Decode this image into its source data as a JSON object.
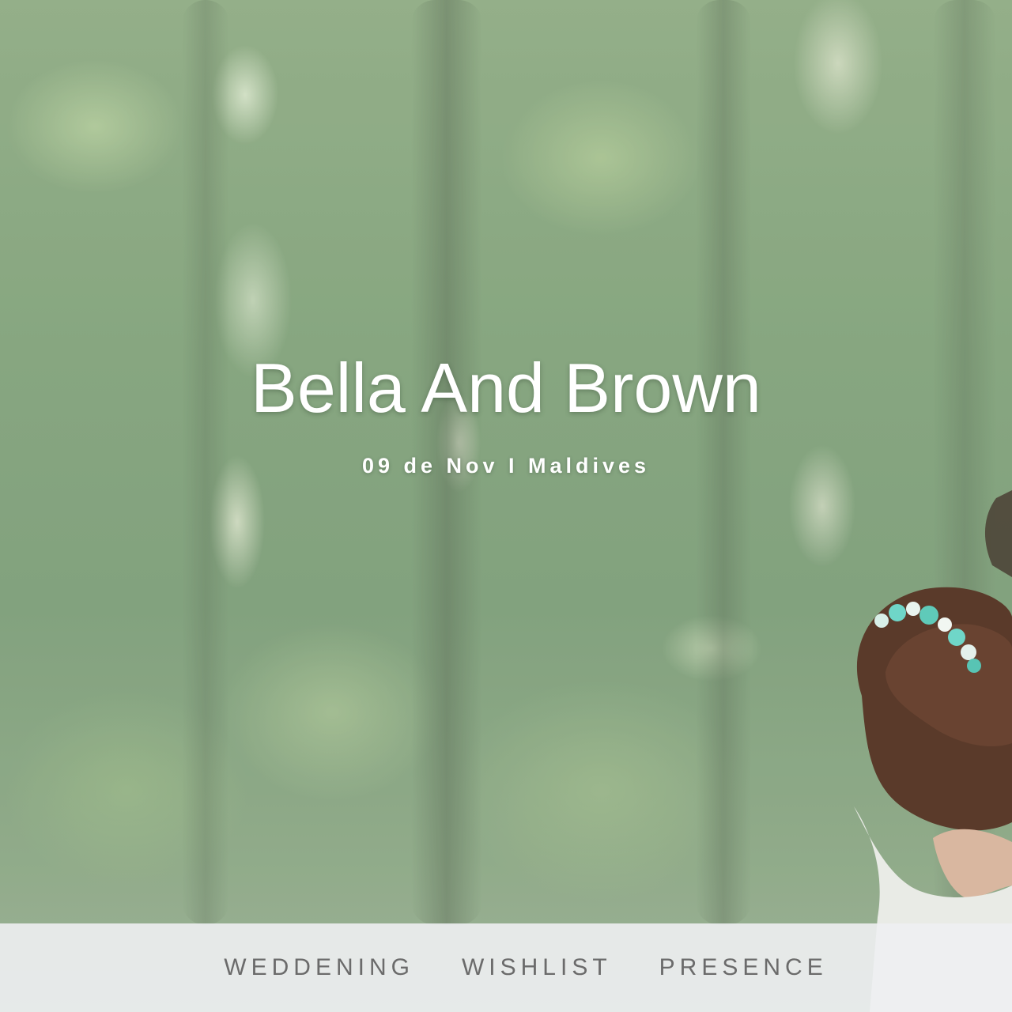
{
  "hero": {
    "title": "Bella And Brown",
    "subtitle": "09 de Nov I Maldives"
  },
  "nav": {
    "items": [
      {
        "label": "WEDDENING"
      },
      {
        "label": "WISHLIST"
      },
      {
        "label": "PRESENCE"
      }
    ]
  },
  "colors": {
    "title_text": "#ffffff",
    "nav_text": "#6b6b6b",
    "nav_background": "#eef0f2",
    "foliage": "#6f9468",
    "flower_crown": "#6fd6c8"
  },
  "icons": {
    "hero_background": "forest-photo",
    "couple": "couple-photo"
  }
}
